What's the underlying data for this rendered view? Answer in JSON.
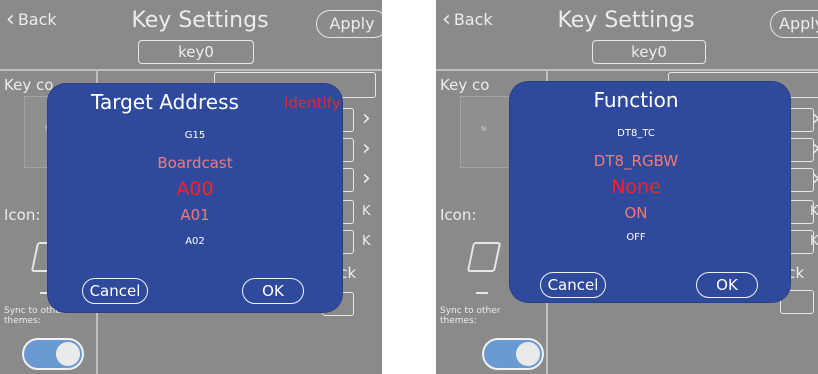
{
  "screens": [
    {
      "header": {
        "back_label": "Back",
        "title": "Key Settings",
        "key_value": "key0",
        "apply_label": "Apply"
      },
      "left_panel": {
        "key_color_label": "Key co",
        "icon_label": "Icon:",
        "sync_label_line1": "Sync to other",
        "sync_label_line2": "themes:",
        "sync_toggle_on": true
      },
      "right_peek": {
        "key_k1": "K",
        "key_k2": "K",
        "back_text": "ack"
      },
      "dialog": {
        "title": "Target Address",
        "extra_label": "Identify",
        "options": [
          "G15",
          "Boardcast",
          "A00",
          "A01",
          "A02"
        ],
        "selected_index": 2,
        "cancel_label": "Cancel",
        "ok_label": "OK"
      }
    },
    {
      "header": {
        "back_label": "Back",
        "title": "Key Settings",
        "key_value": "key0",
        "apply_label": "Apply"
      },
      "left_panel": {
        "key_color_label": "Key co",
        "icon_label": "Icon:",
        "sync_label_line1": "Sync to other",
        "sync_label_line2": "themes:",
        "sync_toggle_on": true
      },
      "right_peek": {
        "key_k1": "K",
        "key_k2": "K",
        "back_text": "ack"
      },
      "dialog": {
        "title": "Function",
        "options": [
          "DT8_TC",
          "DT8_RGBW",
          "None",
          "ON",
          "OFF"
        ],
        "selected_index": 2,
        "cancel_label": "Cancel",
        "ok_label": "OK"
      }
    }
  ],
  "colors": {
    "screen_bg": "#8a8a8a",
    "dialog_bg": "#2f4a9c",
    "selected_red": "#ff1f1f",
    "option_pink": "#f07a7a",
    "identify_red": "#e02a2a",
    "toggle_blue": "#6a9ad4"
  }
}
